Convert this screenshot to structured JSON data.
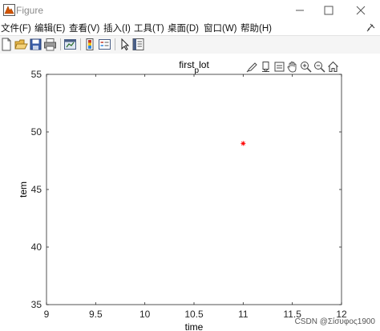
{
  "window": {
    "title": "Figure"
  },
  "menu": [
    "文件(F)",
    "编辑(E)",
    "查看(V)",
    "插入(I)",
    "工具(T)",
    "桌面(D)",
    "窗口(W)",
    "帮助(H)"
  ],
  "toolbar": {
    "icons": [
      "new-figure-icon",
      "open-file-icon",
      "save-icon",
      "print-icon",
      "link-plot-icon",
      "insert-colorbar-icon",
      "insert-legend-icon",
      "edit-plot-icon",
      "property-inspector-icon"
    ]
  },
  "axes_toolbar": {
    "icons": [
      "brush-icon",
      "data-tips-icon",
      "export-icon",
      "pan-icon",
      "zoom-in-icon",
      "zoom-out-icon",
      "home-icon"
    ]
  },
  "watermark": "CSDN @Σίσυφος1900",
  "chart_data": {
    "type": "scatter",
    "title_main": "first",
    "title_sub": "p",
    "title_tail": "lot",
    "xlabel": "time",
    "ylabel": "tem",
    "xlim": [
      9,
      12
    ],
    "ylim": [
      35,
      55
    ],
    "xticks": [
      "9",
      "9.5",
      "10",
      "10.5",
      "11",
      "11.5",
      "12"
    ],
    "yticks": [
      "35",
      "40",
      "45",
      "50",
      "55"
    ],
    "grid": false,
    "series": [
      {
        "marker": "*",
        "color": "#ff0000",
        "points": [
          [
            11,
            49
          ]
        ]
      }
    ]
  }
}
